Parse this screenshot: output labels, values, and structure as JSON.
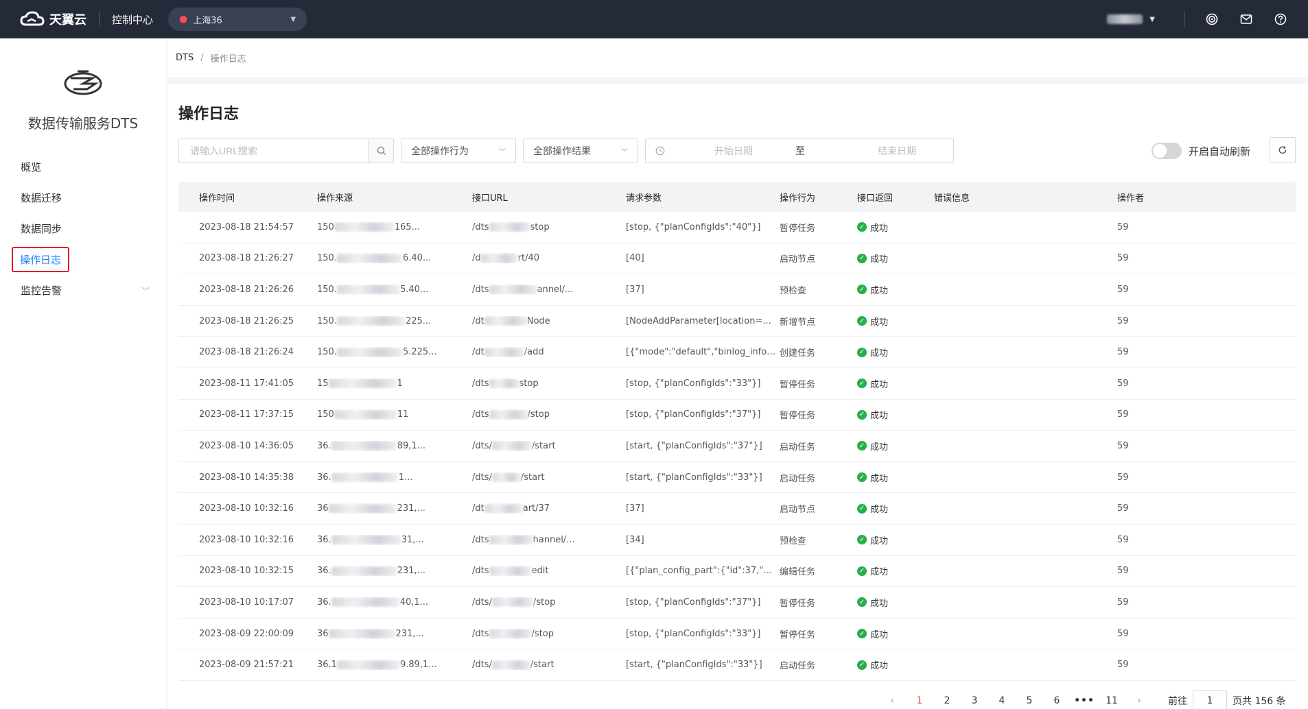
{
  "topbar": {
    "brand": "天翼云",
    "console": "控制中心",
    "region": "上海36",
    "colors": {
      "bg": "#242a38",
      "region_pin": "#ff4d4f"
    },
    "icons": [
      "target-icon",
      "mail-icon",
      "help-icon"
    ]
  },
  "sidebar": {
    "title": "数据传输服务DTS",
    "items": [
      {
        "label": "概览"
      },
      {
        "label": "数据迁移"
      },
      {
        "label": "数据同步"
      },
      {
        "label": "操作日志",
        "active": true
      },
      {
        "label": "监控告警",
        "expandable": true
      }
    ]
  },
  "breadcrumb": {
    "root": "DTS",
    "sep": "/",
    "current": "操作日志"
  },
  "page": {
    "title": "操作日志"
  },
  "filters": {
    "search_placeholder": "请输入URL搜索",
    "action_select": "全部操作行为",
    "result_select": "全部操作结果",
    "date_start": "开始日期",
    "date_sep": "至",
    "date_end": "结束日期",
    "auto_refresh": "开启自动刷新"
  },
  "table": {
    "columns": [
      "操作时间",
      "操作来源",
      "接口URL",
      "请求参数",
      "操作行为",
      "接口返回",
      "错误信息",
      "操作者"
    ],
    "rows": [
      {
        "time": "2023-08-18 21:54:57",
        "src_a": "150",
        "src_b": "165...",
        "url_a": "/dts",
        "url_b": "stop",
        "params": "[stop, {\"planConfigIds\":\"40\"}]",
        "action": "暂停任务",
        "result": "成功",
        "error": "",
        "operator": "59"
      },
      {
        "time": "2023-08-18 21:26:27",
        "src_a": "150.",
        "src_b": "6.40...",
        "url_a": "/d",
        "url_b": "rt/40",
        "params": "[40]",
        "action": "启动节点",
        "result": "成功",
        "error": "",
        "operator": "59"
      },
      {
        "time": "2023-08-18 21:26:26",
        "src_a": "150.",
        "src_b": "5.40...",
        "url_a": "/dts",
        "url_b": "annel/...",
        "params": "[37]",
        "action": "预检查",
        "result": "成功",
        "error": "",
        "operator": "59"
      },
      {
        "time": "2023-08-18 21:26:25",
        "src_a": "150.",
        "src_b": "225...",
        "url_a": "/dt",
        "url_b": "Node",
        "params": "[NodeAddParameter[location=...",
        "action": "新增节点",
        "result": "成功",
        "error": "",
        "operator": "59"
      },
      {
        "time": "2023-08-18 21:26:24",
        "src_a": "150.",
        "src_b": "5.225...",
        "url_a": "/dt",
        "url_b": "/add",
        "params": "[{\"mode\":\"default\",\"binlog_info\":...",
        "action": "创建任务",
        "result": "成功",
        "error": "",
        "operator": "59"
      },
      {
        "time": "2023-08-11 17:41:05",
        "src_a": "15",
        "src_b": "1",
        "url_a": "/dts",
        "url_b": "stop",
        "params": "[stop, {\"planConfigIds\":\"33\"}]",
        "action": "暂停任务",
        "result": "成功",
        "error": "",
        "operator": "59"
      },
      {
        "time": "2023-08-11 17:37:15",
        "src_a": "150",
        "src_b": "11",
        "url_a": "/dts",
        "url_b": "/stop",
        "params": "[stop, {\"planConfigIds\":\"37\"}]",
        "action": "暂停任务",
        "result": "成功",
        "error": "",
        "operator": "59"
      },
      {
        "time": "2023-08-10 14:36:05",
        "src_a": "36.",
        "src_b": "89,1...",
        "url_a": "/dts/",
        "url_b": "/start",
        "params": "[start, {\"planConfigIds\":\"37\"}]",
        "action": "启动任务",
        "result": "成功",
        "error": "",
        "operator": "59"
      },
      {
        "time": "2023-08-10 14:35:38",
        "src_a": "36.",
        "src_b": "1...",
        "url_a": "/dts/",
        "url_b": "/start",
        "params": "[start, {\"planConfigIds\":\"33\"}]",
        "action": "启动任务",
        "result": "成功",
        "error": "",
        "operator": "59"
      },
      {
        "time": "2023-08-10 10:32:16",
        "src_a": "36",
        "src_b": "231,...",
        "url_a": "/dt",
        "url_b": "art/37",
        "params": "[37]",
        "action": "启动节点",
        "result": "成功",
        "error": "",
        "operator": "59"
      },
      {
        "time": "2023-08-10 10:32:16",
        "src_a": "36.",
        "src_b": "31,...",
        "url_a": "/dts",
        "url_b": "hannel/...",
        "params": "[34]",
        "action": "预检查",
        "result": "成功",
        "error": "",
        "operator": "59"
      },
      {
        "time": "2023-08-10 10:32:15",
        "src_a": "36.",
        "src_b": "231,...",
        "url_a": "/dts",
        "url_b": "edit",
        "params": "[{\"plan_config_part\":{\"id\":37,\"m...",
        "action": "编辑任务",
        "result": "成功",
        "error": "",
        "operator": "59"
      },
      {
        "time": "2023-08-10 10:17:07",
        "src_a": "36.",
        "src_b": "40,1...",
        "url_a": "/dts/",
        "url_b": "/stop",
        "params": "[stop, {\"planConfigIds\":\"37\"}]",
        "action": "暂停任务",
        "result": "成功",
        "error": "",
        "operator": "59"
      },
      {
        "time": "2023-08-09 22:00:09",
        "src_a": "36",
        "src_b": "231,...",
        "url_a": "/dts",
        "url_b": "/stop",
        "params": "[stop, {\"planConfigIds\":\"33\"}]",
        "action": "暂停任务",
        "result": "成功",
        "error": "",
        "operator": "59"
      },
      {
        "time": "2023-08-09 21:57:21",
        "src_a": "36.1",
        "src_b": "9.89,1...",
        "url_a": "/dts/",
        "url_b": "/start",
        "params": "[start, {\"planConfigIds\":\"33\"}]",
        "action": "启动任务",
        "result": "成功",
        "error": "",
        "operator": "59"
      }
    ]
  },
  "pagination": {
    "pages": [
      "1",
      "2",
      "3",
      "4",
      "5",
      "6",
      "•••",
      "11"
    ],
    "current": "1",
    "goto_label": "前往",
    "goto_value": "1",
    "total": "页共 156 条"
  }
}
